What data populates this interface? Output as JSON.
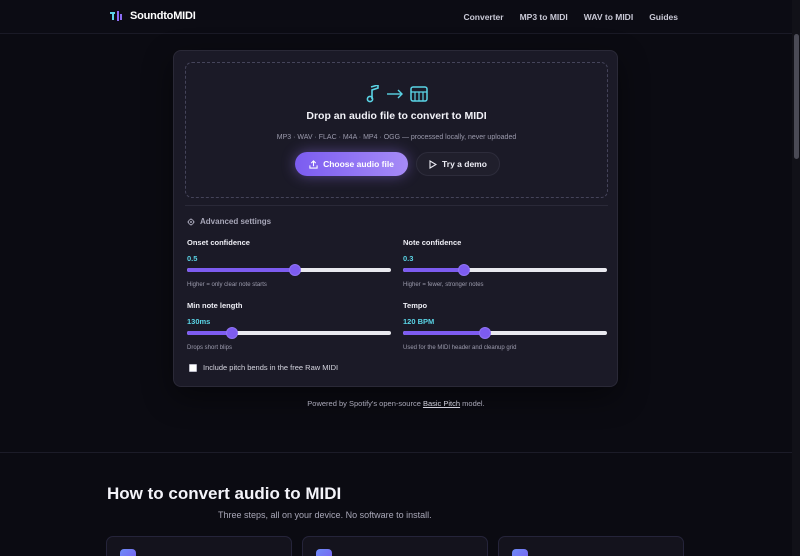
{
  "header": {
    "brand": "SoundtoMIDI",
    "nav": [
      "Converter",
      "MP3 to MIDI",
      "WAV to MIDI",
      "Guides"
    ]
  },
  "dropzone": {
    "title": "Drop an audio file to convert to MIDI",
    "subtitle": "MP3 · WAV · FLAC · M4A · MP4 · OGG — processed locally, never uploaded",
    "choose_label": "Choose audio file",
    "demo_label": "Try a demo"
  },
  "advanced": {
    "title": "Advanced settings",
    "settings": [
      {
        "label": "Onset confidence",
        "value": "0.5",
        "hint": "Higher = only clear note starts",
        "level": 0.53
      },
      {
        "label": "Note confidence",
        "value": "0.3",
        "hint": "Higher = fewer, stronger notes",
        "level": 0.3
      },
      {
        "label": "Min note length",
        "value": "130ms",
        "hint": "Drops short blips",
        "level": 0.22
      },
      {
        "label": "Tempo",
        "value": "120 BPM",
        "hint": "Used for the MIDI header and cleanup grid",
        "level": 0.4
      }
    ],
    "pitch_bend_label": "Include pitch bends in the free Raw MIDI",
    "pitch_bend_checked": false
  },
  "footer_note": {
    "prefix": "Powered by Spotify's open-source ",
    "link": "Basic Pitch",
    "suffix": " model."
  },
  "howto": {
    "title": "How to convert audio to MIDI",
    "subtitle": "Three steps, all on your device. No software to install."
  },
  "colors": {
    "background": "#0b0b12",
    "card": "#1b1a27",
    "accent": "#7d5cf0",
    "value": "#5ad4e6"
  }
}
